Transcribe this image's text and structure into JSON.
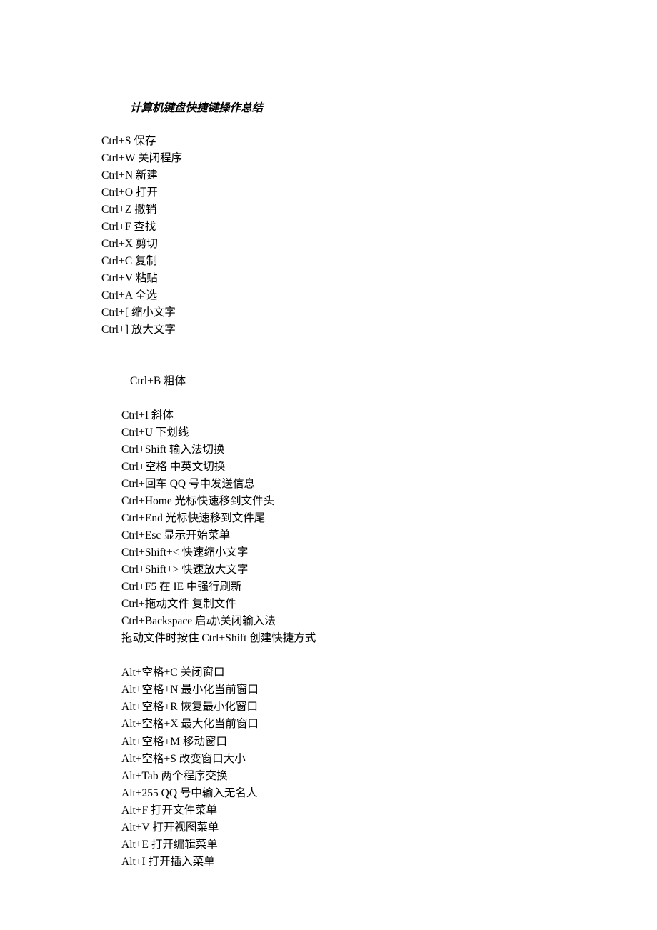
{
  "title": "计算机键盘快捷键操作总结",
  "block_a": [
    "Ctrl+S 保存",
    "Ctrl+W 关闭程序",
    "Ctrl+N 新建",
    "Ctrl+O 打开",
    "Ctrl+Z 撤销",
    "Ctrl+F 查找",
    "Ctrl+X 剪切",
    "Ctrl+C 复制",
    "Ctrl+V 粘贴",
    "Ctrl+A 全选",
    "Ctrl+[ 缩小文字",
    "Ctrl+] 放大文字"
  ],
  "block_b": [
    "Ctrl+B 粗体"
  ],
  "block_c": [
    "Ctrl+I 斜体",
    "Ctrl+U 下划线",
    "Ctrl+Shift 输入法切换",
    "Ctrl+空格 中英文切换",
    "Ctrl+回车 QQ 号中发送信息",
    "Ctrl+Home 光标快速移到文件头",
    "Ctrl+End 光标快速移到文件尾",
    "Ctrl+Esc 显示开始菜单",
    "Ctrl+Shift+< 快速缩小文字",
    "Ctrl+Shift+> 快速放大文字",
    "Ctrl+F5 在 IE 中强行刷新",
    "Ctrl+拖动文件 复制文件",
    "Ctrl+Backspace 启动\\关闭输入法",
    "拖动文件时按住 Ctrl+Shift 创建快捷方式"
  ],
  "block_d": [
    "Alt+空格+C 关闭窗口",
    "Alt+空格+N 最小化当前窗口",
    "Alt+空格+R 恢复最小化窗口",
    "Alt+空格+X 最大化当前窗口",
    "Alt+空格+M 移动窗口",
    "Alt+空格+S 改变窗口大小",
    "Alt+Tab 两个程序交换",
    "Alt+255 QQ 号中输入无名人",
    "Alt+F 打开文件菜单",
    "Alt+V 打开视图菜单",
    "Alt+E 打开编辑菜单",
    "Alt+I 打开插入菜单"
  ]
}
